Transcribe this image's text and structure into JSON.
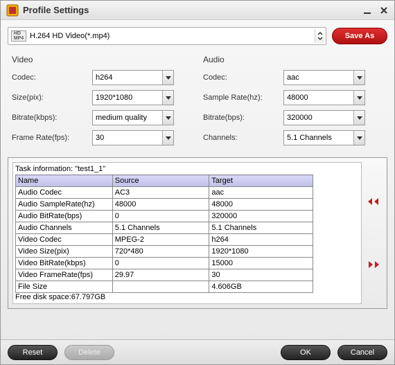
{
  "window": {
    "title": "Profile Settings"
  },
  "profile": {
    "selected": "H.264 HD Video(*.mp4)",
    "saveas_label": "Save As"
  },
  "video": {
    "title": "Video",
    "codec_label": "Codec:",
    "codec_value": "h264",
    "size_label": "Size(pix):",
    "size_value": "1920*1080",
    "bitrate_label": "Bitrate(kbps):",
    "bitrate_value": "medium quality",
    "framerate_label": "Frame Rate(fps):",
    "framerate_value": "30"
  },
  "audio": {
    "title": "Audio",
    "codec_label": "Codec:",
    "codec_value": "aac",
    "samplerate_label": "Sample Rate(hz):",
    "samplerate_value": "48000",
    "bitrate_label": "Bitrate(bps):",
    "bitrate_value": "320000",
    "channels_label": "Channels:",
    "channels_value": "5.1 Channels"
  },
  "task": {
    "title": "Task information: \"test1_1\"",
    "headers": {
      "name": "Name",
      "source": "Source",
      "target": "Target"
    },
    "rows": [
      {
        "name": "Audio Codec",
        "source": "AC3",
        "target": "aac"
      },
      {
        "name": "Audio SampleRate(hz)",
        "source": "48000",
        "target": "48000"
      },
      {
        "name": "Audio BitRate(bps)",
        "source": "0",
        "target": "320000"
      },
      {
        "name": "Audio Channels",
        "source": "5.1 Channels",
        "target": "5.1 Channels"
      },
      {
        "name": "Video Codec",
        "source": "MPEG-2",
        "target": "h264"
      },
      {
        "name": "Video Size(pix)",
        "source": "720*480",
        "target": "1920*1080"
      },
      {
        "name": "Video BitRate(kbps)",
        "source": "0",
        "target": "15000"
      },
      {
        "name": "Video FrameRate(fps)",
        "source": "29.97",
        "target": "30"
      },
      {
        "name": "File Size",
        "source": "",
        "target": "4.606GB"
      }
    ],
    "free_space": "Free disk space:67.797GB"
  },
  "buttons": {
    "reset": "Reset",
    "delete": "Delete",
    "ok": "OK",
    "cancel": "Cancel"
  }
}
